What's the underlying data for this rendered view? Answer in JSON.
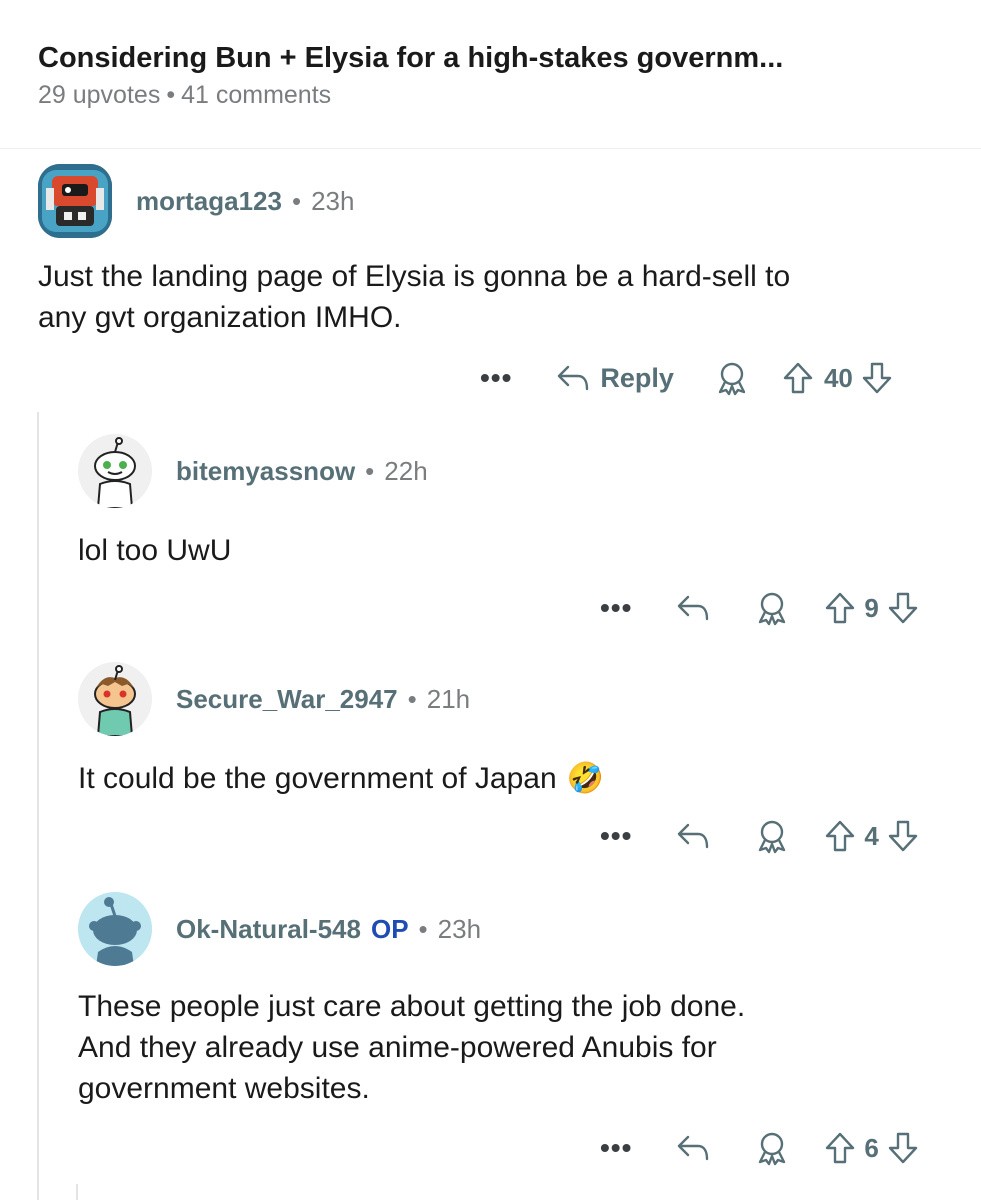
{
  "post": {
    "title": "Considering Bun + Elysia for a high-stakes governm...",
    "upvotes": "29 upvotes",
    "separator": "•",
    "comments": "41 comments"
  },
  "comments": [
    {
      "username": "mortaga123",
      "time": "23h",
      "body_lines": [
        "Just the landing page of Elysia is gonna be a hard-sell to",
        "any gvt organization IMHO."
      ],
      "reply_label": "Reply",
      "votes": "40"
    },
    {
      "username": "bitemyassnow",
      "time": "22h",
      "body_lines": [
        "lol too UwU"
      ],
      "votes": "9"
    },
    {
      "username": "Secure_War_2947",
      "time": "21h",
      "body_lines": [
        "It could be the government of Japan"
      ],
      "emoji": "🤣",
      "votes": "4"
    },
    {
      "username": "Ok-Natural-548",
      "op_badge": "OP",
      "time": "23h",
      "body_lines": [
        "These people just care about getting the job done.",
        "And they already use anime-powered Anubis for",
        "government websites."
      ],
      "votes": "6"
    }
  ],
  "icons": {
    "more": "more-options-icon",
    "reply": "reply-arrow-icon",
    "award": "award-icon",
    "upvote": "upvote-arrow-icon",
    "downvote": "downvote-arrow-icon"
  },
  "colors": {
    "username": "#576f76",
    "meta": "#7a7d80",
    "op": "#1f4cb3",
    "thread_line": "#e4e4e4"
  }
}
